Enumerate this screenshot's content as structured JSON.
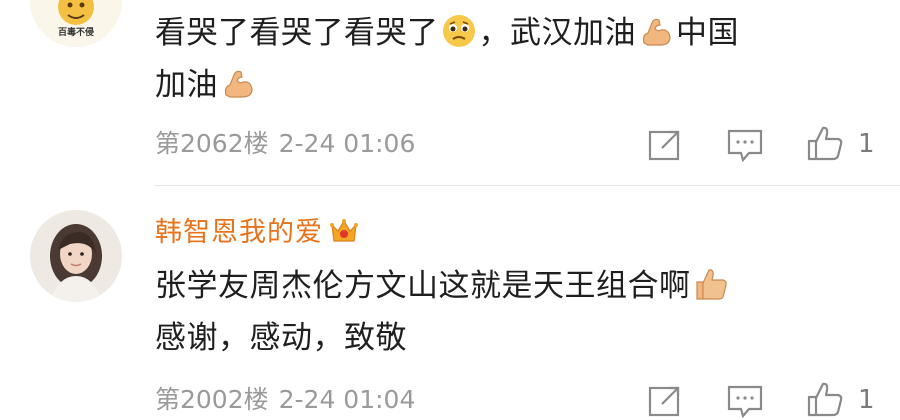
{
  "comments": [
    {
      "avatar_text": "百毒不侵",
      "lines": [
        {
          "before": "看哭了看哭了看哭了",
          "emoji1": "crying-face-emoji",
          "middle": "，武汉加油",
          "emoji2": "flexed-biceps-emoji",
          "after": "中国"
        },
        {
          "before": "加油",
          "emoji1": "flexed-biceps-emoji",
          "after": ""
        }
      ],
      "floor": "第2062楼",
      "time": "2-24 01:06",
      "likes": "1"
    },
    {
      "username": "韩智恩我的爱",
      "badge": "crown-icon",
      "lines": [
        {
          "before": "张学友周杰伦方文山这就是天王组合啊",
          "emoji1": "thumbs-up-emoji",
          "after": ""
        },
        {
          "before": "感谢，感动，致敬"
        }
      ],
      "floor": "第2002楼",
      "time": "2-24 01:04",
      "likes": "1"
    }
  ],
  "colors": {
    "username": "#e8731a",
    "meta": "#9a9a9a",
    "icon": "#8a8a8a"
  }
}
